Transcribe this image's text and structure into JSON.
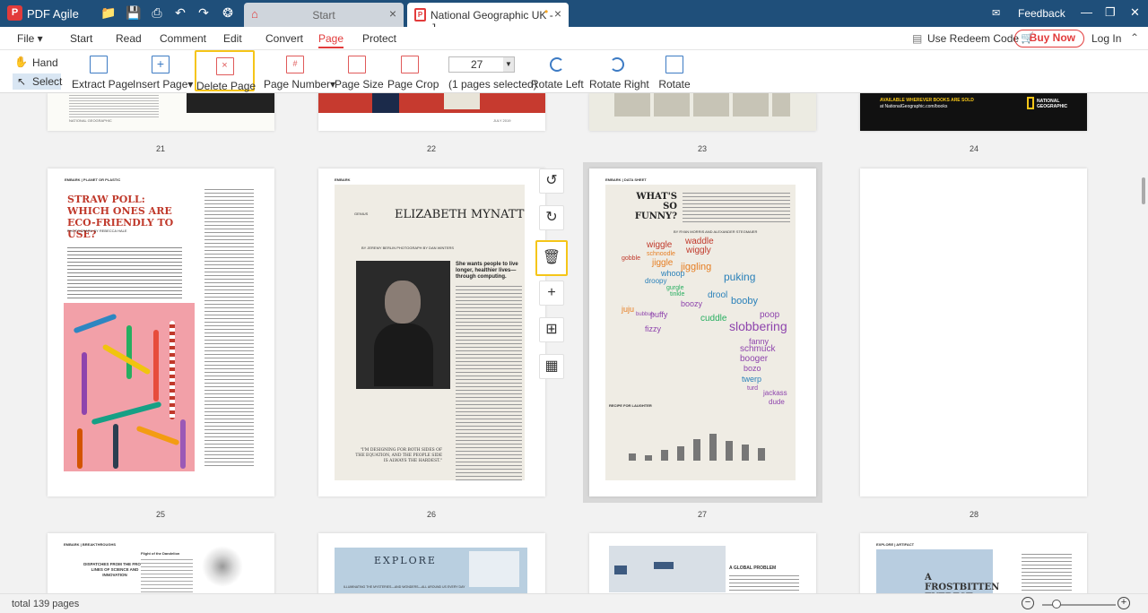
{
  "app": {
    "name": "PDF Agile",
    "logo_letter": "P"
  },
  "tabs": [
    {
      "label": "Start",
      "icon": "home-icon"
    },
    {
      "label": "National Geographic UK - J...",
      "icon": "pdf-file-icon",
      "modified_mark": "•"
    }
  ],
  "titlebar": {
    "feedback": "Feedback"
  },
  "menu": {
    "file": "File",
    "items": [
      "Start",
      "Read",
      "Comment",
      "Edit",
      "Convert",
      "Page",
      "Protect"
    ],
    "active": "Page",
    "redeem": "Use Redeem Code",
    "buy_now": "Buy Now",
    "login": "Log In"
  },
  "toolbar": {
    "hand": "Hand",
    "select": "Select",
    "extract_page": "Extract Page",
    "insert_page": "Insert Page",
    "delete_page": "Delete Page",
    "page_number": "Page Number",
    "page_size": "Page Size",
    "page_crop": "Page Crop",
    "page_input": "27",
    "pages_selected": "(1 pages selected)",
    "rotate_left": "Rotate Left",
    "rotate_right": "Rotate Right",
    "rotate": "Rotate"
  },
  "pages": {
    "row1": [
      "21",
      "22",
      "23",
      "24"
    ],
    "row2": [
      "25",
      "26",
      "27",
      "28"
    ]
  },
  "page_content": {
    "p21_footer": "NATIONAL GEOGRAPHIC",
    "p22_footer": "JULY 2019",
    "p24_banner": "AVAILABLE WHEREVER BOOKS ARE SOLD",
    "p24_site": "at NationalGeographic.com/books",
    "p24_brand": "NATIONAL GEOGRAPHIC",
    "p25_kicker": "EMBARK | PLANET OR PLASTIC",
    "p25_title": "STRAW POLL: WHICH ONES ARE ECO-FRIENDLY TO USE?",
    "p25_credit": "PHOTOGRAPH BY REBECCA HALE",
    "p26_kicker": "EMBARK",
    "p26_label": "GENIUS",
    "p26_title": "ELIZABETH MYNATT",
    "p26_credit": "BY JEREMY BERLIN  PHOTOGRAPH BY DAN WINTERS",
    "p26_deck": "She wants people to live longer, healthier lives—through computing.",
    "p26_quote": "\"I'M DESIGNING FOR BOTH SIDES OF THE EQUATION, AND THE PEOPLE SIDE IS ALWAYS THE HARDEST.\"",
    "p27_kicker": "EMBARK | DATA SHEET",
    "p27_title": "WHAT'S SO FUNNY?",
    "p27_credit": "BY RYAN MORRIS AND ALEXANDER STEGMAIER",
    "p27_words": [
      "wiggle",
      "waddle",
      "wiggly",
      "gobble",
      "schnoodle",
      "jiggle",
      "jiggling",
      "whoop",
      "puking",
      "droopy",
      "gurgle",
      "tinkle",
      "drool",
      "boozy",
      "booby",
      "juju",
      "bubbub",
      "puffy",
      "slobbering",
      "fizzy",
      "cuddle",
      "poop",
      "fanny",
      "schmuck",
      "booger",
      "bozo",
      "twerp",
      "turd",
      "jackass",
      "dude"
    ],
    "p27_recipe": "RECIPE FOR LAUGHTER",
    "p28_blank": "",
    "p29_kicker": "EMBARK | BREAKTHROUGHS",
    "p29_head": "DISPATCHES FROM THE FRONT LINES OF SCIENCE AND INNOVATION",
    "p29_sub": "Flight of the Dandelion",
    "p30_title": "EXPLORE",
    "p30_caption": "ILLUMINATING THE MYSTERIES—AND WONDERS—ALL AROUND US EVERY DAY",
    "p31_head": "A GLOBAL PROBLEM",
    "p32_kicker": "EXPLORE | ARTIFACT",
    "p32_title": "A FROSTBITTEN EVEREST DESCENT"
  },
  "status": {
    "total": "total 139 pages"
  },
  "colors": {
    "titlebar": "#1f4f7a",
    "accent": "#e23b3b",
    "highlight": "#f5c518",
    "pink_page": "#f2a0a8"
  }
}
